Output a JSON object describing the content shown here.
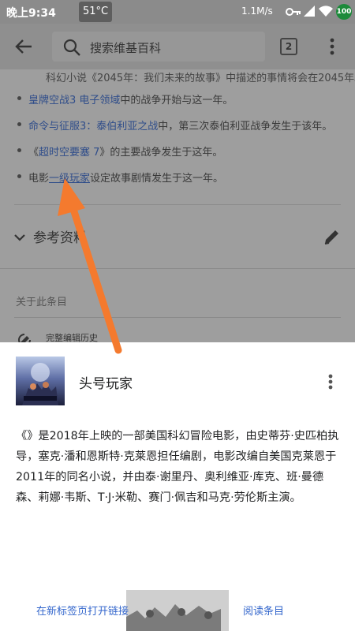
{
  "status_bar": {
    "time": "晚上9:34",
    "temperature": "51°C",
    "net_speed": "1.1M/s",
    "battery": "100"
  },
  "app_bar": {
    "search_placeholder": "搜索维基百科",
    "tab_count": "2"
  },
  "article": {
    "partial_line": "科幻小说《2045年：我们未来的故事》中描述的事情将会在2045年。",
    "bullets": [
      {
        "link": "皇牌空战3 电子领域",
        "text": "中的战争开始与这一年。"
      },
      {
        "link": "命令与征服3：泰伯利亚之战",
        "text": "中，第三次泰伯利亚战争发生于该年。"
      },
      {
        "prefix": "《",
        "link": "超时空要塞 7",
        "text": "》的主要战争发生于这年。"
      },
      {
        "prefix": "电影",
        "link": "一级玩家",
        "text": "设定故事剧情发生于这一年。"
      }
    ],
    "references_title": "参考资料",
    "about_title": "关于此条目",
    "history_label": "完整编辑历史"
  },
  "preview_sheet": {
    "title": "头号玩家",
    "description": "《》是2018年上映的一部美国科幻冒险电影，由史蒂芬·史匹柏执导，塞克·潘和恩斯特·克莱恩担任编剧，电影改编自美国克莱恩于2011年的同名小说，并由泰·谢里丹、奥利维亚·库克、班·曼德森、莉娜·韦斯、T·J·米勒、赛门·佩吉和马克·劳伦斯主演。",
    "open_new_tab": "在新标签页打开链接",
    "read_article": "阅读条目"
  },
  "colors": {
    "link": "#3366cc",
    "annotation_arrow": "#f47a2e",
    "dim_overlay": "#9e9e9e"
  },
  "icons": [
    "back-arrow-icon",
    "search-icon",
    "tabs-icon",
    "more-vert-icon",
    "chevron-down-icon",
    "edit-pencil-icon",
    "history-icon",
    "kebab-menu-icon"
  ]
}
